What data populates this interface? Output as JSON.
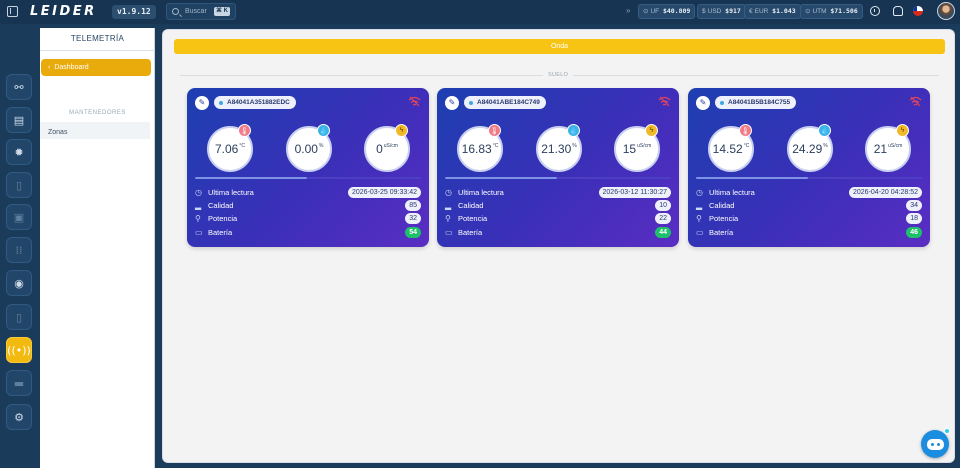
{
  "app": {
    "logo": "LEIDER",
    "version": "v1.9.12"
  },
  "search": {
    "placeholder": "Buscar",
    "shortcut": "⌘ K"
  },
  "tickers": [
    {
      "symbol": "⊙",
      "code": "UF",
      "value": "$40.809"
    },
    {
      "symbol": "$",
      "code": "USD",
      "value": "$917"
    },
    {
      "symbol": "€",
      "code": "EUR",
      "value": "$1.043"
    },
    {
      "symbol": "⊙",
      "code": "UTM",
      "value": "$71.506"
    }
  ],
  "header_icons": [
    "clock-icon",
    "bell-icon",
    "chile-flag-icon",
    "user-avatar"
  ],
  "rail": [
    {
      "icon": "network-icon",
      "state": "normal"
    },
    {
      "icon": "book-icon",
      "state": "normal"
    },
    {
      "icon": "bug-icon",
      "state": "normal"
    },
    {
      "icon": "clipboard-icon",
      "state": "dim"
    },
    {
      "icon": "image-icon",
      "state": "dim"
    },
    {
      "icon": "grid-icon",
      "state": "dim"
    },
    {
      "icon": "compass-icon",
      "state": "normal"
    },
    {
      "icon": "document-icon",
      "state": "dim"
    },
    {
      "icon": "broadcast-icon",
      "state": "active"
    },
    {
      "icon": "chat-icon",
      "state": "dim"
    },
    {
      "icon": "settings-icon",
      "state": "normal"
    }
  ],
  "submenu": {
    "title": "TELEMETRÍA",
    "dashboard_label": "Dashboard",
    "section_label": "MANTENEDORES",
    "items": [
      "Zonas"
    ]
  },
  "main": {
    "banner": "Onda",
    "section": "SUELO",
    "cards": [
      {
        "device_id": "A84041A351882EDC",
        "temperature": {
          "value": "7.06",
          "unit": "°C"
        },
        "humidity": {
          "value": "0.00",
          "unit": "%"
        },
        "conductivity": {
          "value": "0",
          "unit": "uS/cm"
        },
        "rows": [
          {
            "label": "Ultima lectura",
            "value": "2026-03-25 09:33:42"
          },
          {
            "label": "Calidad",
            "value": "85"
          },
          {
            "label": "Potencia",
            "value": "32"
          },
          {
            "label": "Batería",
            "value": "54"
          }
        ]
      },
      {
        "device_id": "A84041ABE184C749",
        "temperature": {
          "value": "16.83",
          "unit": "°C"
        },
        "humidity": {
          "value": "21.30",
          "unit": "%"
        },
        "conductivity": {
          "value": "15",
          "unit": "uS/cm"
        },
        "rows": [
          {
            "label": "Ultima lectura",
            "value": "2026-03-12 11:30:27"
          },
          {
            "label": "Calidad",
            "value": "10"
          },
          {
            "label": "Potencia",
            "value": "22"
          },
          {
            "label": "Batería",
            "value": "44"
          }
        ]
      },
      {
        "device_id": "A84041B5B184C755",
        "temperature": {
          "value": "14.52",
          "unit": "°C"
        },
        "humidity": {
          "value": "24.29",
          "unit": "%"
        },
        "conductivity": {
          "value": "21",
          "unit": "uS/cm"
        },
        "rows": [
          {
            "label": "Ultima lectura",
            "value": "2026-04-20 04:28:52"
          },
          {
            "label": "Calidad",
            "value": "34"
          },
          {
            "label": "Potencia",
            "value": "18"
          },
          {
            "label": "Batería",
            "value": "46"
          }
        ]
      }
    ]
  },
  "colors": {
    "brand_navy": "#173552",
    "accent_yellow": "#f2b90f",
    "card_gradient_start": "#1d3fb1",
    "card_gradient_end": "#5a2dc3",
    "battery_green": "#1fc06b"
  }
}
